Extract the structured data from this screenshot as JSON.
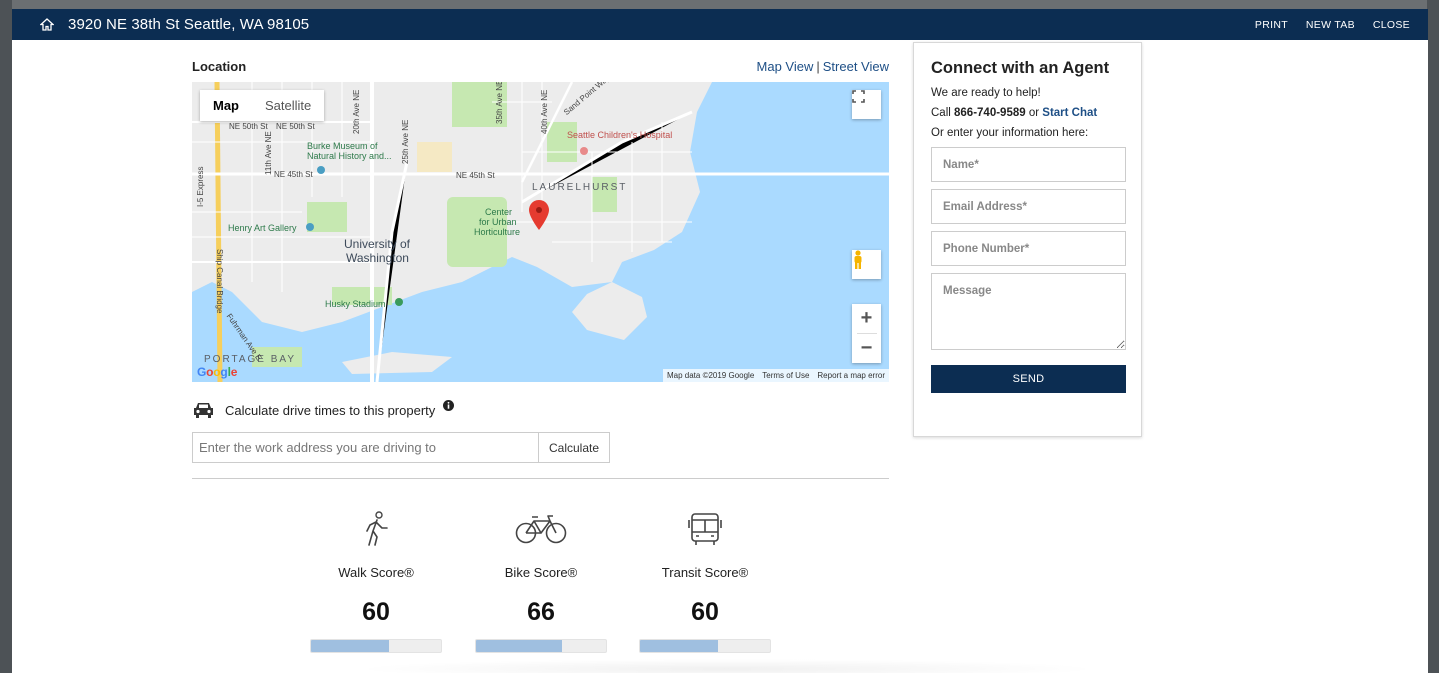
{
  "header": {
    "title": "3920 NE 38th St Seattle, WA 98105",
    "actions": {
      "print": "PRINT",
      "new_tab": "NEW TAB",
      "close": "CLOSE"
    }
  },
  "location": {
    "label": "Location",
    "map_view_link": "Map View",
    "separator": "|",
    "street_view_link": "Street View"
  },
  "map": {
    "tabs": {
      "map": "Map",
      "satellite": "Satellite"
    },
    "active_tab": "Map",
    "zoom_in": "+",
    "zoom_out": "−",
    "footer": {
      "data": "Map data ©2019 Google",
      "terms": "Terms of Use",
      "report": "Report a map error"
    },
    "logo": "Google",
    "labels": {
      "seattle_childrens": "Seattle Children's Hospital",
      "laurelhurst": "LAURELHURST",
      "burke_museum_1": "Burke Museum of",
      "burke_museum_2": "Natural History and...",
      "uw_1": "University of",
      "uw_2": "Washington",
      "henry_art": "Henry Art Gallery",
      "center_urban_1": "Center",
      "center_urban_2": "for Urban",
      "center_urban_3": "Horticulture",
      "husky": "Husky Stadium",
      "portage": "PORTAGE BAY",
      "ne45_1": "NE 45th St",
      "ne45_2": "NE 45th St",
      "ne50_1": "NE 50th St",
      "ne50_2": "NE 50th St",
      "i5": "I-5 Express",
      "ship_canal": "Ship Canal Bridge",
      "ave20": "20th Ave NE",
      "ave25": "25th Ave NE",
      "ave35": "35th Ave NE",
      "ave40": "40th Ave NE",
      "ave11": "11th Ave NE",
      "sand_point": "Sand Point Way NE",
      "fuhrman": "Fuhrman Ave E"
    }
  },
  "drive": {
    "label": "Calculate drive times to this property",
    "input_placeholder": "Enter the work address you are driving to",
    "button": "Calculate"
  },
  "scores": [
    {
      "label": "Walk Score®",
      "value": "60",
      "fraction": 0.6,
      "icon": "walk-icon"
    },
    {
      "label": "Bike Score®",
      "value": "66",
      "fraction": 0.66,
      "icon": "bike-icon"
    },
    {
      "label": "Transit Score®",
      "value": "60",
      "fraction": 0.6,
      "icon": "transit-icon"
    }
  ],
  "agent": {
    "title": "Connect with an Agent",
    "intro": "We are ready to help!",
    "call_prefix": "Call",
    "phone": "866-740-9589",
    "or_text": "or",
    "chat_link": "Start Chat",
    "enter_info": "Or enter your information here:",
    "fields": {
      "name": "Name*",
      "email": "Email Address*",
      "phone": "Phone Number*",
      "message": "Message"
    },
    "send": "SEND"
  },
  "colors": {
    "header_bg": "#0c2d52",
    "link": "#1e4f86",
    "score_fill": "#9fbfe0",
    "water": "#aadaff",
    "park": "#c6e8b1"
  }
}
